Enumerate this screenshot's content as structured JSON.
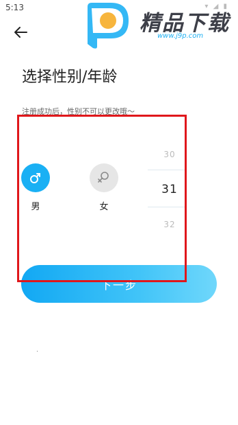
{
  "status_bar": {
    "time": "5:13",
    "icons_text": "▾ ◢ ▮"
  },
  "watermark": {
    "title": "精品下载",
    "url": "www.j9p.com",
    "badge_letter": "P"
  },
  "page": {
    "title": "选择性别/年龄",
    "hint": "注册成功后，性别不可以更改哦～"
  },
  "gender": {
    "male_label": "男",
    "female_label": "女",
    "selected": "男"
  },
  "age_picker": {
    "prev": "30",
    "current": "31",
    "next": "32"
  },
  "next_button": {
    "label": "下一步"
  },
  "colors": {
    "accent": "#1ab0f4",
    "highlight": "#e0171b",
    "unselected": "#e6e6e6"
  }
}
